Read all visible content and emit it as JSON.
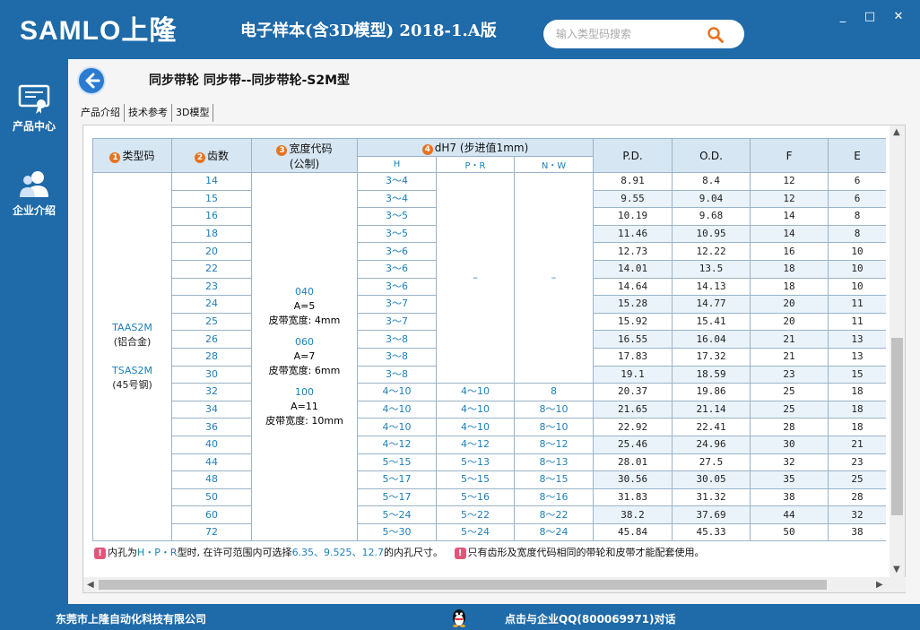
{
  "app": {
    "logo": "SAMLO上隆",
    "title": "电子样本(含3D模型) 2018-1.A版",
    "search_placeholder": "输入类型码搜索",
    "window": {
      "min": "_",
      "max": "□",
      "close": "✕"
    }
  },
  "sidebar": {
    "items": [
      {
        "label": "产品中心",
        "icon": "certificate-icon"
      },
      {
        "label": "企业介绍",
        "icon": "users-icon"
      }
    ]
  },
  "page": {
    "title": "同步带轮 同步带--同步带轮-S2M型",
    "tabs": [
      "产品介绍",
      "技术参考",
      "3D模型"
    ]
  },
  "table": {
    "headers": {
      "type_code": "类型码",
      "teeth": "齿数",
      "width_code": "宽度代码",
      "width_code_sub": "(公制)",
      "dh7": "dH7 (步进值1mm)",
      "h": "H",
      "pr": "P・R",
      "nw": "N・W",
      "pd": "P.D.",
      "od": "O.D.",
      "f": "F",
      "e": "E"
    },
    "badges": [
      "1",
      "2",
      "3",
      "4"
    ],
    "type_cell": [
      "TAAS2M",
      "(铝合金)",
      "TSAS2M",
      "(45号钢)"
    ],
    "width_groups": [
      {
        "code": "040",
        "a": "A=5",
        "belt": "皮带宽度: 4mm"
      },
      {
        "code": "060",
        "a": "A=7",
        "belt": "皮带宽度: 6mm"
      },
      {
        "code": "100",
        "a": "A=11",
        "belt": "皮带宽度: 10mm"
      }
    ],
    "dash": "–",
    "rows": [
      {
        "teeth": "14",
        "h": "3～4",
        "pr": "",
        "nw": "",
        "pd": "8.91",
        "od": "8.4",
        "f": "12",
        "e": "6"
      },
      {
        "teeth": "15",
        "h": "3～4",
        "pr": "",
        "nw": "",
        "pd": "9.55",
        "od": "9.04",
        "f": "12",
        "e": "6"
      },
      {
        "teeth": "16",
        "h": "3～5",
        "pr": "",
        "nw": "",
        "pd": "10.19",
        "od": "9.68",
        "f": "14",
        "e": "8"
      },
      {
        "teeth": "18",
        "h": "3～5",
        "pr": "",
        "nw": "",
        "pd": "11.46",
        "od": "10.95",
        "f": "14",
        "e": "8"
      },
      {
        "teeth": "20",
        "h": "3～6",
        "pr": "",
        "nw": "",
        "pd": "12.73",
        "od": "12.22",
        "f": "16",
        "e": "10"
      },
      {
        "teeth": "22",
        "h": "3～6",
        "pr": "",
        "nw": "",
        "pd": "14.01",
        "od": "13.5",
        "f": "18",
        "e": "10"
      },
      {
        "teeth": "23",
        "h": "3～6",
        "pr": "",
        "nw": "",
        "pd": "14.64",
        "od": "14.13",
        "f": "18",
        "e": "10"
      },
      {
        "teeth": "24",
        "h": "3～7",
        "pr": "",
        "nw": "",
        "pd": "15.28",
        "od": "14.77",
        "f": "20",
        "e": "11"
      },
      {
        "teeth": "25",
        "h": "3～7",
        "pr": "",
        "nw": "",
        "pd": "15.92",
        "od": "15.41",
        "f": "20",
        "e": "11"
      },
      {
        "teeth": "26",
        "h": "3～8",
        "pr": "",
        "nw": "",
        "pd": "16.55",
        "od": "16.04",
        "f": "21",
        "e": "13"
      },
      {
        "teeth": "28",
        "h": "3～8",
        "pr": "",
        "nw": "",
        "pd": "17.83",
        "od": "17.32",
        "f": "21",
        "e": "13"
      },
      {
        "teeth": "30",
        "h": "3～8",
        "pr": "",
        "nw": "",
        "pd": "19.1",
        "od": "18.59",
        "f": "23",
        "e": "15"
      },
      {
        "teeth": "32",
        "h": "4～10",
        "pr": "4～10",
        "nw": "8",
        "pd": "20.37",
        "od": "19.86",
        "f": "25",
        "e": "18"
      },
      {
        "teeth": "34",
        "h": "4～10",
        "pr": "4～10",
        "nw": "8～10",
        "pd": "21.65",
        "od": "21.14",
        "f": "25",
        "e": "18"
      },
      {
        "teeth": "36",
        "h": "4～10",
        "pr": "4～10",
        "nw": "8～10",
        "pd": "22.92",
        "od": "22.41",
        "f": "28",
        "e": "18"
      },
      {
        "teeth": "40",
        "h": "4～12",
        "pr": "4～12",
        "nw": "8～12",
        "pd": "25.46",
        "od": "24.96",
        "f": "30",
        "e": "21"
      },
      {
        "teeth": "44",
        "h": "5～15",
        "pr": "5～13",
        "nw": "8～13",
        "pd": "28.01",
        "od": "27.5",
        "f": "32",
        "e": "23"
      },
      {
        "teeth": "48",
        "h": "5～17",
        "pr": "5～15",
        "nw": "8～15",
        "pd": "30.56",
        "od": "30.05",
        "f": "35",
        "e": "25"
      },
      {
        "teeth": "50",
        "h": "5～17",
        "pr": "5～16",
        "nw": "8～16",
        "pd": "31.83",
        "od": "31.32",
        "f": "38",
        "e": "28"
      },
      {
        "teeth": "60",
        "h": "5～24",
        "pr": "5～22",
        "nw": "8～22",
        "pd": "38.2",
        "od": "37.69",
        "f": "44",
        "e": "32"
      },
      {
        "teeth": "72",
        "h": "5～30",
        "pr": "5～24",
        "nw": "8～24",
        "pd": "45.84",
        "od": "45.33",
        "f": "50",
        "e": "38"
      }
    ]
  },
  "notes": {
    "icon": "!",
    "n1_a": "内孔为",
    "n1_b": "H・P・R",
    "n1_c": "型时, 在许可范围内可选择",
    "n1_d": "6.35、9.525、12.7",
    "n1_e": "的内孔尺寸。",
    "n2": "只有齿形及宽度代码相同的带轮和皮带才能配套使用。"
  },
  "footer": {
    "company": "东莞市上隆自动化科技有限公司",
    "qq": "点击与企业QQ(800069971)对话"
  },
  "colors": {
    "brand": "#1f6aa8",
    "accent": "#e8731f",
    "link": "#1d7fb8"
  }
}
